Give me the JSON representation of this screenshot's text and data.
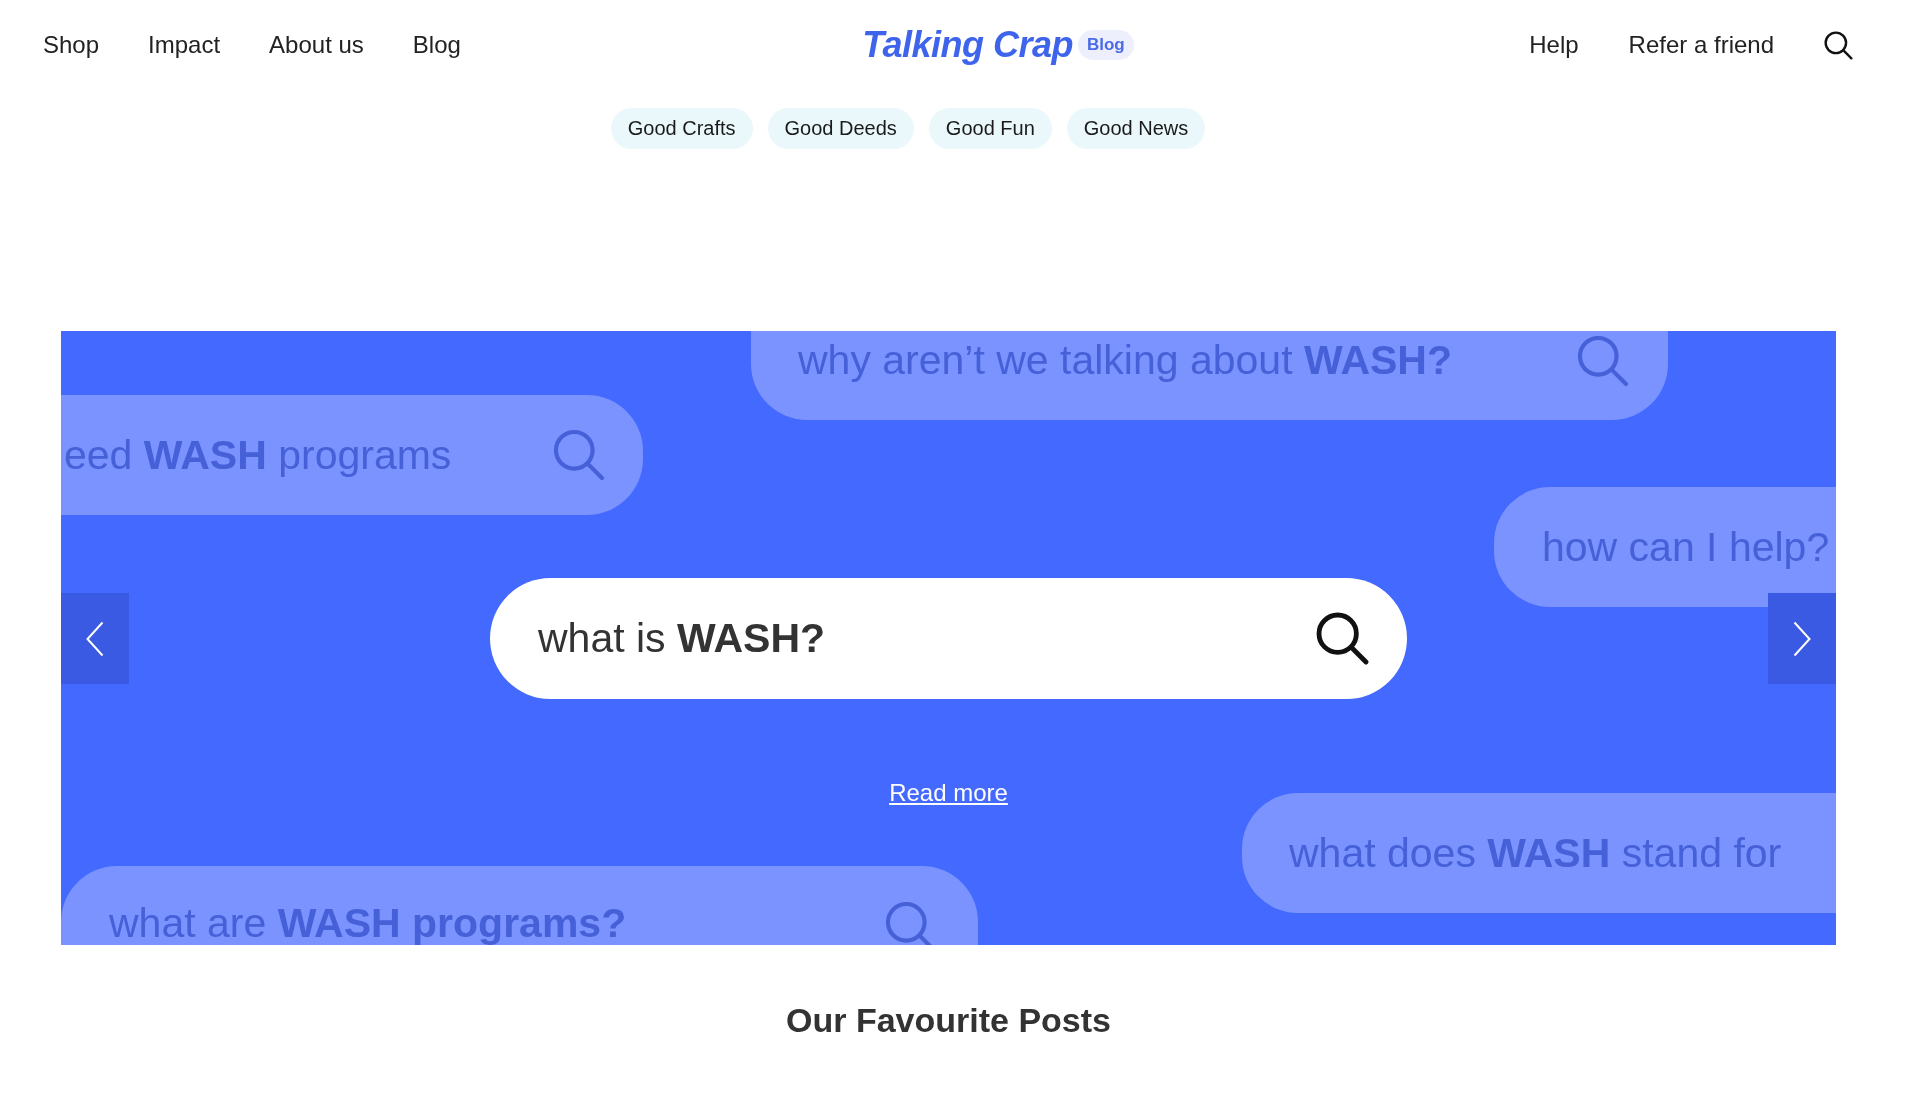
{
  "header": {
    "nav_left": [
      "Shop",
      "Impact",
      "About us",
      "Blog"
    ],
    "logo": {
      "text": "Talking Crap",
      "tag": "Blog"
    },
    "nav_right": [
      "Help",
      "Refer a friend"
    ]
  },
  "categories": [
    "Good Crafts",
    "Good Deeds",
    "Good Fun",
    "Good News"
  ],
  "hero": {
    "bubbles": [
      {
        "text": "why aren’t we talking about **WASH?**",
        "icon": true
      },
      {
        "text": "eed **WASH** programs",
        "icon": true
      },
      {
        "text": "how can I help?",
        "icon": false
      },
      {
        "text": "what does **WASH** stand for",
        "icon": false
      },
      {
        "text": "what are **WASH programs?**",
        "icon": true
      }
    ],
    "search": {
      "value": "what is **WASH?**"
    },
    "read_more": "Read more"
  },
  "section_title": "Our Favourite Posts"
}
